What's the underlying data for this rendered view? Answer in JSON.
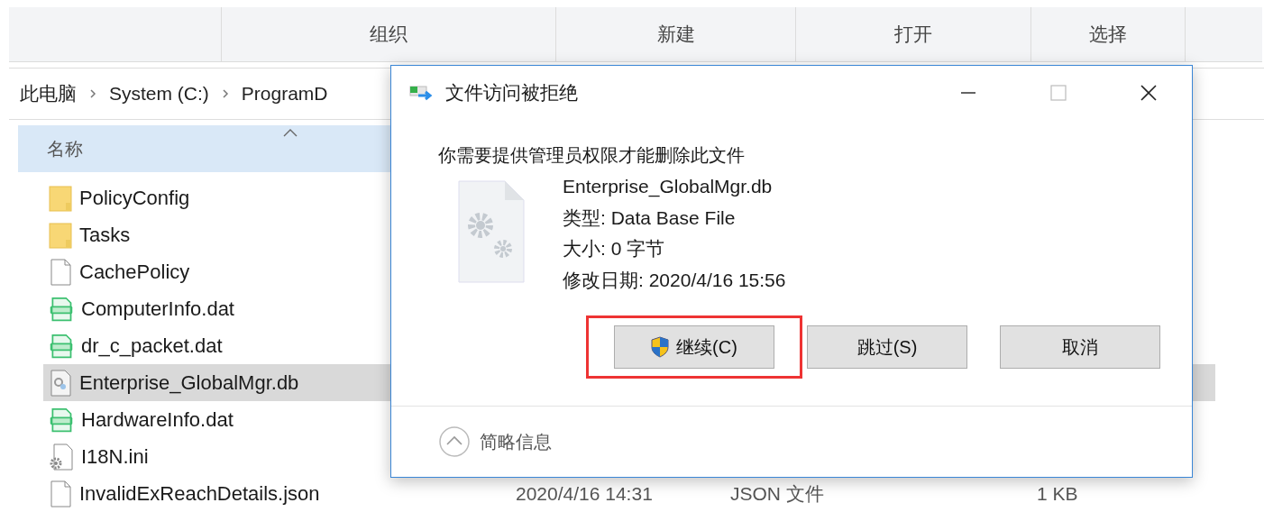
{
  "ribbon": {
    "groups": [
      "组织",
      "新建",
      "打开",
      "选择"
    ]
  },
  "breadcrumb": [
    "此电脑",
    "System (C:)",
    "ProgramD"
  ],
  "file_list": {
    "columns": [
      "名称"
    ],
    "rows": [
      {
        "name": "PolicyConfig",
        "kind": "folder",
        "selected": false
      },
      {
        "name": "Tasks",
        "kind": "folder",
        "selected": false
      },
      {
        "name": "CachePolicy",
        "kind": "blank",
        "selected": false
      },
      {
        "name": "ComputerInfo.dat",
        "kind": "vcd",
        "selected": false
      },
      {
        "name": "dr_c_packet.dat",
        "kind": "vcd",
        "selected": false
      },
      {
        "name": "Enterprise_GlobalMgr.db",
        "kind": "db",
        "selected": true
      },
      {
        "name": "HardwareInfo.dat",
        "kind": "vcd",
        "selected": false
      },
      {
        "name": "I18N.ini",
        "kind": "ini",
        "selected": false
      },
      {
        "name": "InvalidExReachDetails.json",
        "kind": "blank",
        "selected": false,
        "date": "2020/4/16 14:31",
        "type": "JSON 文件",
        "size": "1 KB"
      }
    ]
  },
  "dialog": {
    "title": "文件访问被拒绝",
    "message": "你需要提供管理员权限才能删除此文件",
    "file": {
      "name": "Enterprise_GlobalMgr.db",
      "type": "类型: Data Base File",
      "size": "大小: 0 字节",
      "modified": "修改日期: 2020/4/16 15:56"
    },
    "buttons": [
      {
        "label": "继续(C)",
        "kind": "shield",
        "highlighted": true
      },
      {
        "label": "跳过(S)",
        "kind": "plain",
        "highlighted": false
      },
      {
        "label": "取消",
        "kind": "plain",
        "highlighted": false
      }
    ],
    "footer": "简略信息"
  }
}
